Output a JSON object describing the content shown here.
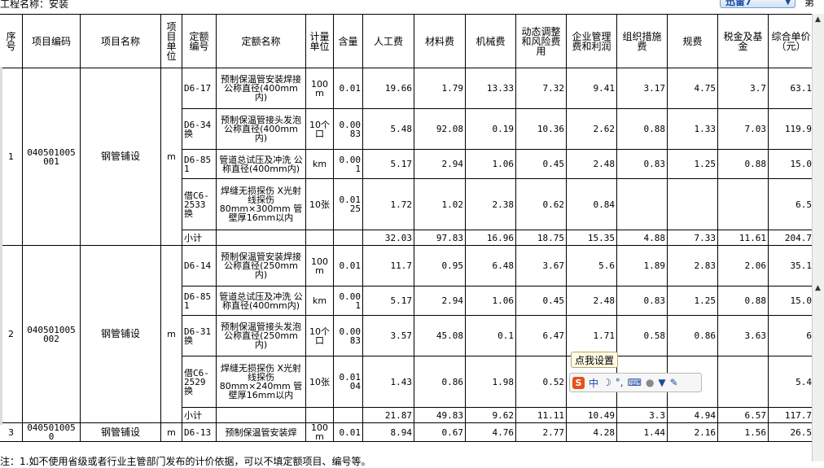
{
  "header": {
    "project_label": "工程名称：安装",
    "top_button": "迅雷7",
    "top_button_icon": "chevron-down-icon",
    "top_right_text": "第"
  },
  "columns": [
    "序号",
    "项目编码",
    "项目名称",
    "项目单位",
    "定额编号",
    "定额名称",
    "计量单位",
    "含量",
    "人工费",
    "材料费",
    "机械费",
    "动态调整和风险费用",
    "企业管理费和利润",
    "组织措施费",
    "规费",
    "税金及基金",
    "综合单价（元）"
  ],
  "column_labels": {
    "seq": "序号",
    "code": "项目编码",
    "name": "项目名称",
    "unit": "项目单位",
    "quota_no": "定额编号",
    "quota_name": "定额名称",
    "meas_unit": "计量单位",
    "amount": "含量",
    "labor": "人工费",
    "material": "材料费",
    "machine": "机械费",
    "risk": "动态调整和风险费用",
    "mgmt": "企业管理费和利润",
    "measure": "组织措施费",
    "fee": "规费",
    "tax": "税金及基金",
    "unit_price": "综合单价（元）"
  },
  "groups": [
    {
      "seq": "1",
      "code": "040501005001",
      "name": "钢管铺设",
      "unit": "m",
      "rows": [
        {
          "quota_no": "D6-17",
          "quota_name": "预制保温管安装焊接 公称直径(400mm内)",
          "meas_unit": "100m",
          "amount": "0.01",
          "labor": "19.66",
          "material": "1.79",
          "machine": "13.33",
          "risk": "7.32",
          "mgmt": "9.41",
          "measure": "3.17",
          "fee": "4.75",
          "tax": "3.7",
          "unit_price": "63.1"
        },
        {
          "quota_no": "D6-34换",
          "quota_name": "预制保温管接头发泡 公称直径(400mm内)",
          "meas_unit": "10个口",
          "amount": "0.0083",
          "labor": "5.48",
          "material": "92.08",
          "machine": "0.19",
          "risk": "10.36",
          "mgmt": "2.62",
          "measure": "0.88",
          "fee": "1.33",
          "tax": "7.03",
          "unit_price": "119.9"
        },
        {
          "quota_no": "D6-851",
          "quota_name": "管道总试压及冲洗 公称直径(400mm内)",
          "meas_unit": "km",
          "amount": "0.001",
          "labor": "5.17",
          "material": "2.94",
          "machine": "1.06",
          "risk": "0.45",
          "mgmt": "2.48",
          "measure": "0.83",
          "fee": "1.25",
          "tax": "0.88",
          "unit_price": "15.0"
        },
        {
          "quota_no": "借C6-2533换",
          "quota_name": "焊缝无损探伤 X光射线探伤 80mm×300mm 管壁厚16mm以内",
          "meas_unit": "10张",
          "amount": "0.0125",
          "labor": "1.72",
          "material": "1.02",
          "machine": "2.38",
          "risk": "0.62",
          "mgmt": "0.84",
          "measure": "",
          "fee": "",
          "tax": "",
          "unit_price": "6.5"
        }
      ],
      "subtotal": {
        "label": "小计",
        "labor": "32.03",
        "material": "97.83",
        "machine": "16.96",
        "risk": "18.75",
        "mgmt": "15.35",
        "measure": "4.88",
        "fee": "7.33",
        "tax": "11.61",
        "unit_price": "204.7"
      }
    },
    {
      "seq": "2",
      "code": "040501005002",
      "name": "钢管铺设",
      "unit": "m",
      "rows": [
        {
          "quota_no": "D6-14",
          "quota_name": "预制保温管安装焊接 公称直径(250mm内)",
          "meas_unit": "100m",
          "amount": "0.01",
          "labor": "11.7",
          "material": "0.95",
          "machine": "6.48",
          "risk": "3.67",
          "mgmt": "5.6",
          "measure": "1.89",
          "fee": "2.83",
          "tax": "2.06",
          "unit_price": "35.1"
        },
        {
          "quota_no": "D6-851",
          "quota_name": "管道总试压及冲洗 公称直径(400mm内)",
          "meas_unit": "km",
          "amount": "0.001",
          "labor": "5.17",
          "material": "2.94",
          "machine": "1.06",
          "risk": "0.45",
          "mgmt": "2.48",
          "measure": "0.83",
          "fee": "1.25",
          "tax": "0.88",
          "unit_price": "15.0"
        },
        {
          "quota_no": "D6-31换",
          "quota_name": "预制保温管接头发泡 公称直径(250mm内)",
          "meas_unit": "10个口",
          "amount": "0.0083",
          "labor": "3.57",
          "material": "45.08",
          "machine": "0.1",
          "risk": "6.47",
          "mgmt": "1.71",
          "measure": "0.58",
          "fee": "0.86",
          "tax": "3.63",
          "unit_price": "6"
        },
        {
          "quota_no": "借C6-2529换",
          "quota_name": "焊缝无损探伤 X光射线探伤 80mm×240mm 管壁厚16mm以内",
          "meas_unit": "10张",
          "amount": "0.0104",
          "labor": "1.43",
          "material": "0.86",
          "machine": "1.98",
          "risk": "0.52",
          "mgmt": "",
          "measure": "",
          "fee": "",
          "tax": "",
          "unit_price": "5.4"
        }
      ],
      "subtotal": {
        "label": "小计",
        "labor": "21.87",
        "material": "49.83",
        "machine": "9.62",
        "risk": "11.11",
        "mgmt": "10.49",
        "measure": "3.3",
        "fee": "4.94",
        "tax": "6.57",
        "unit_price": "117.7"
      }
    },
    {
      "seq": "3",
      "code": "0405010050",
      "name": "钢管铺设",
      "unit": "m",
      "rows": [
        {
          "quota_no": "D6-13",
          "quota_name": "预制保温管安装焊",
          "meas_unit": "100m",
          "amount": "0.01",
          "labor": "8.94",
          "material": "0.67",
          "machine": "4.76",
          "risk": "2.77",
          "mgmt": "4.28",
          "measure": "1.44",
          "fee": "2.16",
          "tax": "1.56",
          "unit_price": "26.5"
        }
      ]
    }
  ],
  "footnote": "注：1.如不使用省级或者行业主管部门发布的计价依据，可以不填定额项目、编号等。",
  "ime": {
    "tooltip": "点我设置",
    "logo_text": "S",
    "lang": "中",
    "icons": [
      "moon-icon",
      "punctuation-icon",
      "keyboard-icon",
      "user-icon",
      "shirt-icon",
      "wrench-icon"
    ]
  }
}
